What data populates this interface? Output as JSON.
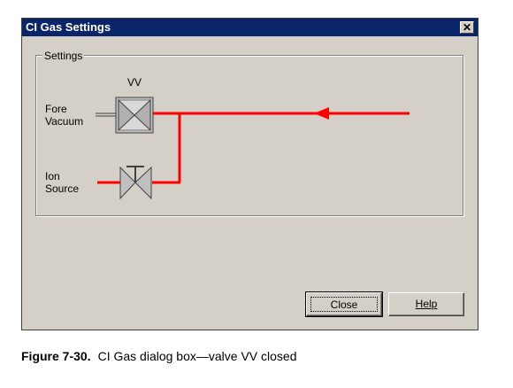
{
  "window": {
    "title": "CI Gas Settings",
    "close_glyph": "✕"
  },
  "group": {
    "label": "Settings"
  },
  "valve": {
    "label": "VV"
  },
  "labels": {
    "fore_line1": "Fore",
    "fore_line2": "Vacuum",
    "ion_line1": "Ion",
    "ion_line2": "Source"
  },
  "buttons": {
    "close": "Close",
    "help": "Help"
  },
  "caption": {
    "number": "Figure 7-30.",
    "text": "CI Gas dialog box—valve VV closed"
  },
  "colors": {
    "pipe": "#ff0000",
    "titlebar": "#0a246a",
    "dialog": "#d4d0c8"
  }
}
